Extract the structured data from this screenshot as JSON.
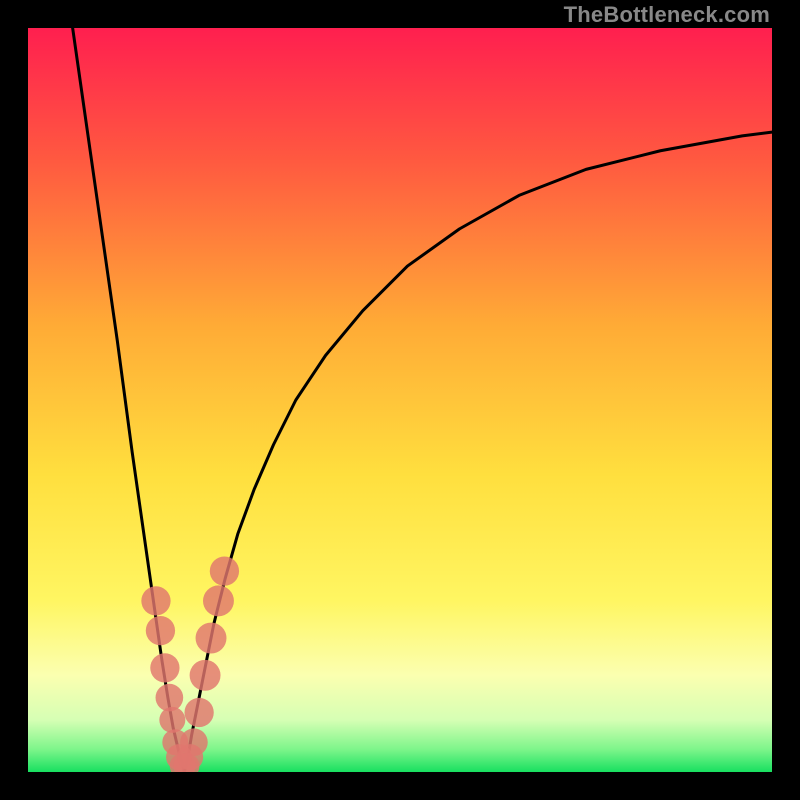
{
  "watermark": "TheBottleneck.com",
  "colors": {
    "top": "#ff1f4f",
    "upper_mid": "#ff7a3a",
    "mid": "#ffd43a",
    "low_mid": "#fff56a",
    "pale": "#f9ffb8",
    "green": "#18e060",
    "curve": "#000000",
    "marker": "#e0766e",
    "frame_bg": "#000000"
  },
  "chart_data": {
    "type": "line",
    "title": "",
    "xlabel": "",
    "ylabel": "",
    "xlim": [
      0,
      100
    ],
    "ylim": [
      0,
      100
    ],
    "x_optimum": 21,
    "series": [
      {
        "name": "left-branch",
        "x": [
          6,
          8,
          10,
          12,
          14,
          15,
          16,
          17,
          18,
          18.8,
          19.5,
          20.2,
          20.8,
          21
        ],
        "y": [
          100,
          86,
          72,
          58,
          43,
          36,
          29,
          22,
          15,
          10,
          6,
          3,
          1,
          0
        ]
      },
      {
        "name": "right-branch",
        "x": [
          21,
          21.5,
          22,
          22.8,
          23.8,
          25,
          26.5,
          28.2,
          30.4,
          33,
          36,
          40,
          45,
          51,
          58,
          66,
          75,
          85,
          96,
          100
        ],
        "y": [
          0,
          2,
          5,
          9,
          14,
          20,
          26,
          32,
          38,
          44,
          50,
          56,
          62,
          68,
          73,
          77.5,
          81,
          83.5,
          85.5,
          86
        ]
      }
    ],
    "markers": {
      "name": "data-points",
      "points": [
        {
          "x": 17.2,
          "y": 23,
          "r": 2.6
        },
        {
          "x": 17.8,
          "y": 19,
          "r": 2.6
        },
        {
          "x": 18.4,
          "y": 14,
          "r": 2.6
        },
        {
          "x": 19.0,
          "y": 10,
          "r": 2.4
        },
        {
          "x": 19.4,
          "y": 7,
          "r": 2.2
        },
        {
          "x": 19.8,
          "y": 4,
          "r": 2.2
        },
        {
          "x": 20.3,
          "y": 2,
          "r": 2.2
        },
        {
          "x": 20.8,
          "y": 0.8,
          "r": 2.2
        },
        {
          "x": 21.3,
          "y": 0.8,
          "r": 2.2
        },
        {
          "x": 21.8,
          "y": 2,
          "r": 2.2
        },
        {
          "x": 22.3,
          "y": 4,
          "r": 2.4
        },
        {
          "x": 23.0,
          "y": 8,
          "r": 2.6
        },
        {
          "x": 23.8,
          "y": 13,
          "r": 2.8
        },
        {
          "x": 24.6,
          "y": 18,
          "r": 2.8
        },
        {
          "x": 25.6,
          "y": 23,
          "r": 2.8
        },
        {
          "x": 26.4,
          "y": 27,
          "r": 2.6
        }
      ]
    },
    "gradient_stops": [
      {
        "offset": 0,
        "color": "#ff1f4f"
      },
      {
        "offset": 18,
        "color": "#ff5a40"
      },
      {
        "offset": 40,
        "color": "#ffab36"
      },
      {
        "offset": 60,
        "color": "#ffdf3e"
      },
      {
        "offset": 77,
        "color": "#fff662"
      },
      {
        "offset": 87,
        "color": "#fbffb0"
      },
      {
        "offset": 93,
        "color": "#d6ffb4"
      },
      {
        "offset": 97,
        "color": "#7cf58a"
      },
      {
        "offset": 100,
        "color": "#18e060"
      }
    ]
  }
}
